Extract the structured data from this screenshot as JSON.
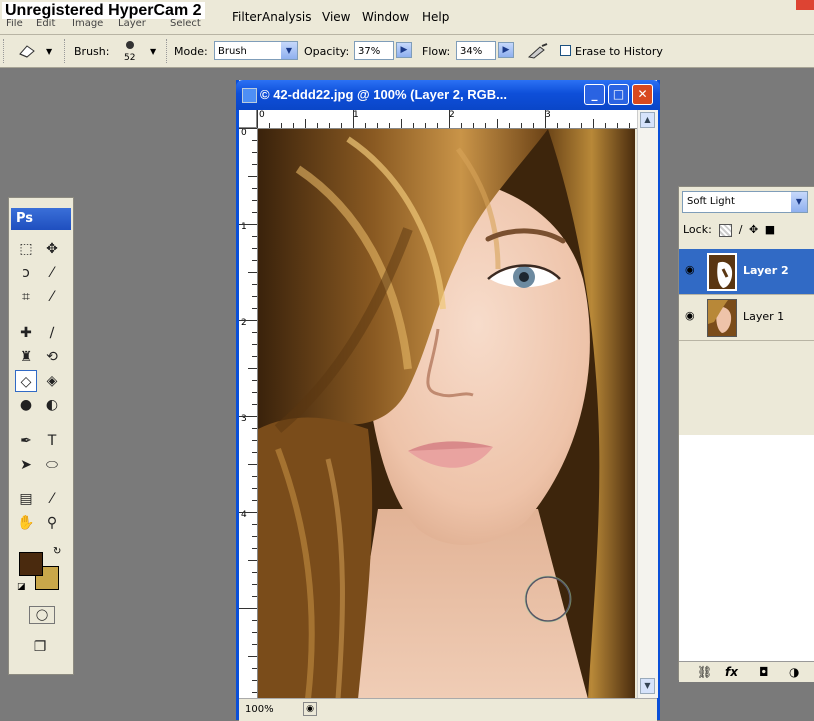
{
  "watermark": "Unregistered HyperCam 2",
  "menubar": {
    "items": [
      "File",
      "Edit",
      "Image",
      "Layer",
      "Select",
      "Filter",
      "Analysis",
      "View",
      "Window",
      "Help"
    ]
  },
  "options": {
    "brush_label": "Brush:",
    "brush_size": "52",
    "mode_label": "Mode:",
    "mode_value": "Brush",
    "opacity_label": "Opacity:",
    "opacity_value": "37%",
    "flow_label": "Flow:",
    "flow_value": "34%",
    "erase_history_label": "Erase to History"
  },
  "toolbox": {
    "logo": "Ps",
    "colors": {
      "foreground": "#4a2a0e",
      "background": "#c9a74a"
    }
  },
  "document": {
    "title": "42-ddd22.jpg @ 100% (Layer 2, RGB...",
    "zoom": "100%",
    "ruler_h": [
      "0",
      "1",
      "2",
      "3"
    ],
    "ruler_v": [
      "0",
      "1",
      "2",
      "3",
      "4"
    ]
  },
  "layers": {
    "blend_mode": "Soft Light",
    "lock_label": "Lock:",
    "items": [
      {
        "name": "Layer 2",
        "selected": true
      },
      {
        "name": "Layer 1",
        "selected": false
      }
    ]
  }
}
